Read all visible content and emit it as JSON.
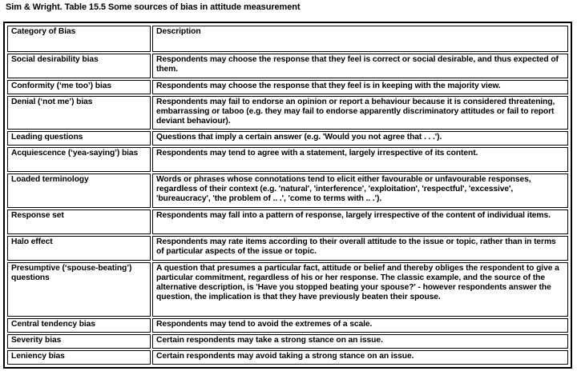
{
  "caption": "Sim & Wright. Table 15.5 Some sources of bias in attitude measurement",
  "table": {
    "headers": [
      "Category of Bias",
      "Description"
    ],
    "rows": [
      {
        "category": "Social desirability bias",
        "description": "Respondents may choose the response that they feel is correct or social desirable, and thus expected of them."
      },
      {
        "category": "Conformity (‘me too’) bias",
        "description": "Respondents may choose the response that they feel is in keeping with the majority view."
      },
      {
        "category": "Denial (‘not me’) bias",
        "description": "Respondents may fail to endorse an opinion or report a behaviour because it is considered threatening, embarrassing or taboo (e.g. they may fail to endorse apparently discriminatory attitudes or fail to report deviant behaviour)."
      },
      {
        "category": "Leading questions",
        "description": "Questions that imply a certain answer (e.g. 'Would you not agree that . . .')."
      },
      {
        "category": "Acquiescence (‘yea-saying’) bias",
        "description": "Respondents may tend to agree with a statement, largely irrespective of its content."
      },
      {
        "category": "Loaded terminology",
        "description": "Words or phrases whose connotations tend to elicit either favourable or unfavourable responses, regardless of their context (e.g. 'natural', 'interference', 'exploitation', 'respectful', 'excessive', 'bureaucracy', 'the problem of .. .', 'come to terms with .. .')."
      },
      {
        "category": "Response set",
        "description": "Respondents may fall into a pattern of response, largely irrespective of the content of individual items."
      },
      {
        "category": "Halo effect",
        "description": "Respondents may rate items according to their overall attitude to the issue or topic, rather than in terms of particular aspects of the issue or topic."
      },
      {
        "category": "Presumptive (‘spouse-beating’) questions",
        "description": "A question that presumes a particular fact, attitude or belief and thereby obliges the respondent to give a particular commitment, regardless of his or her response. The classic example, and the source of the alternative description, is 'Have you stopped beating your spouse?' - however respondents answer the question, the implication is that they have previously beaten their spouse."
      },
      {
        "category": "Central tendency bias",
        "description": "Respondents may tend to avoid the extremes of a scale."
      },
      {
        "category": "Severity bias",
        "description": "Certain respondents may take a strong stance on an issue."
      },
      {
        "category": "Leniency bias",
        "description": "Certain respondents may avoid taking a strong stance on an issue."
      }
    ]
  }
}
